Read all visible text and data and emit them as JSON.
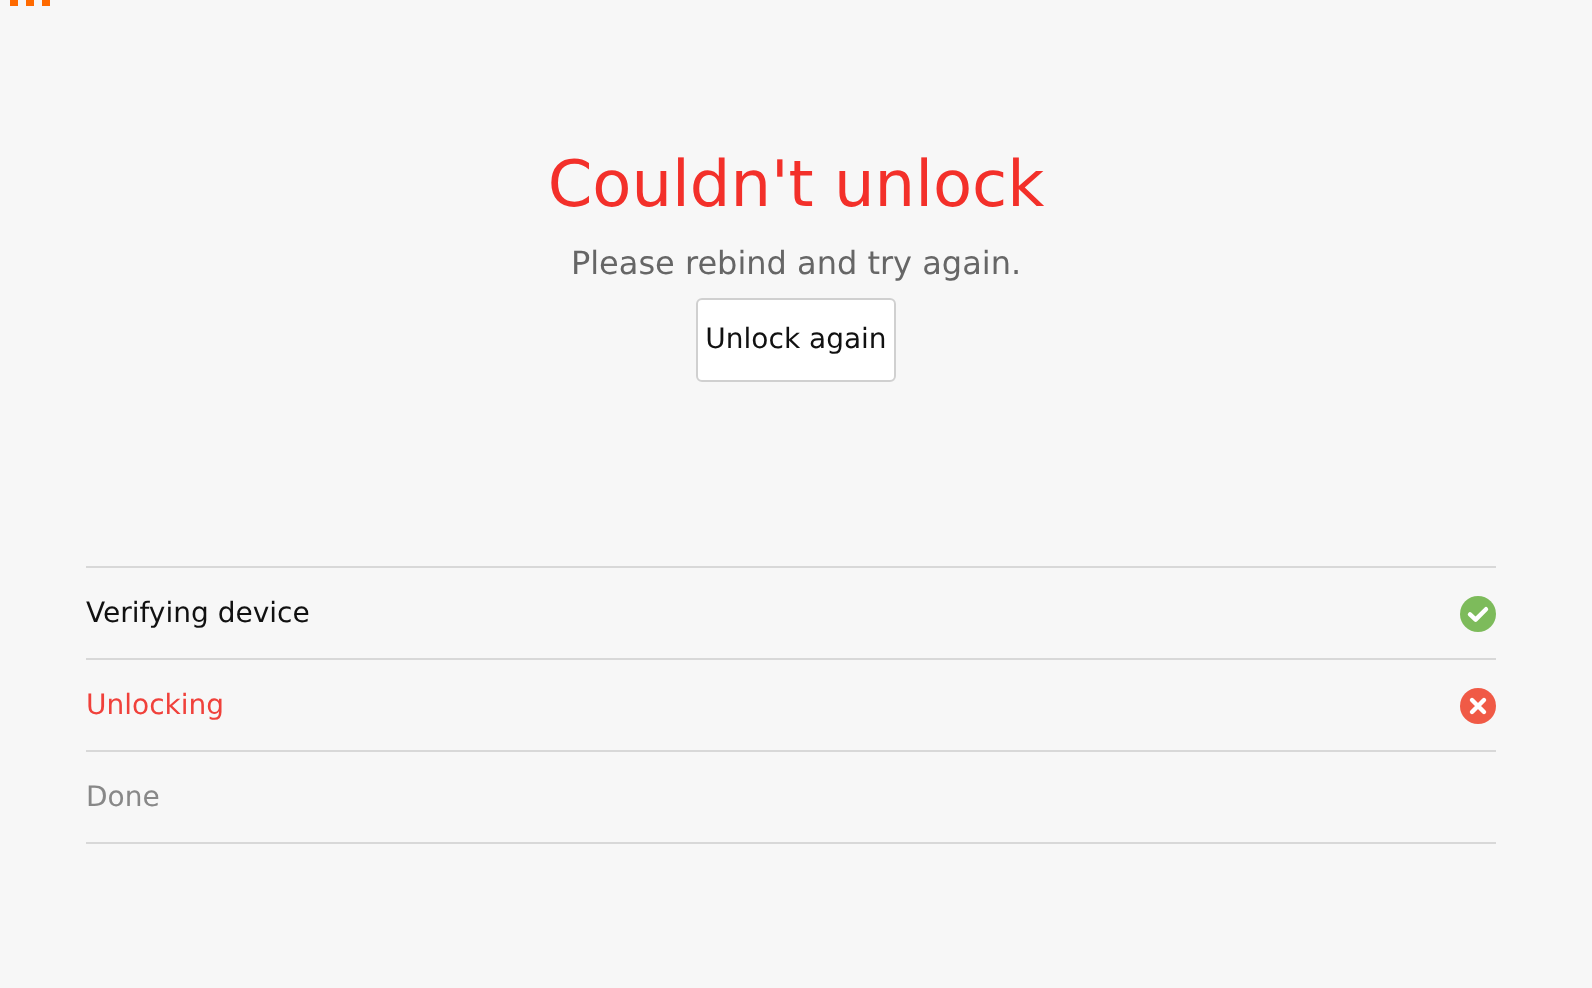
{
  "title": "Couldn't unlock",
  "message": "Please rebind and try again.",
  "button": "Unlock again",
  "steps": [
    {
      "label": "Verifying device",
      "kind": "done"
    },
    {
      "label": "Unlocking",
      "kind": "failed"
    },
    {
      "label": "Done",
      "kind": "pending"
    }
  ]
}
